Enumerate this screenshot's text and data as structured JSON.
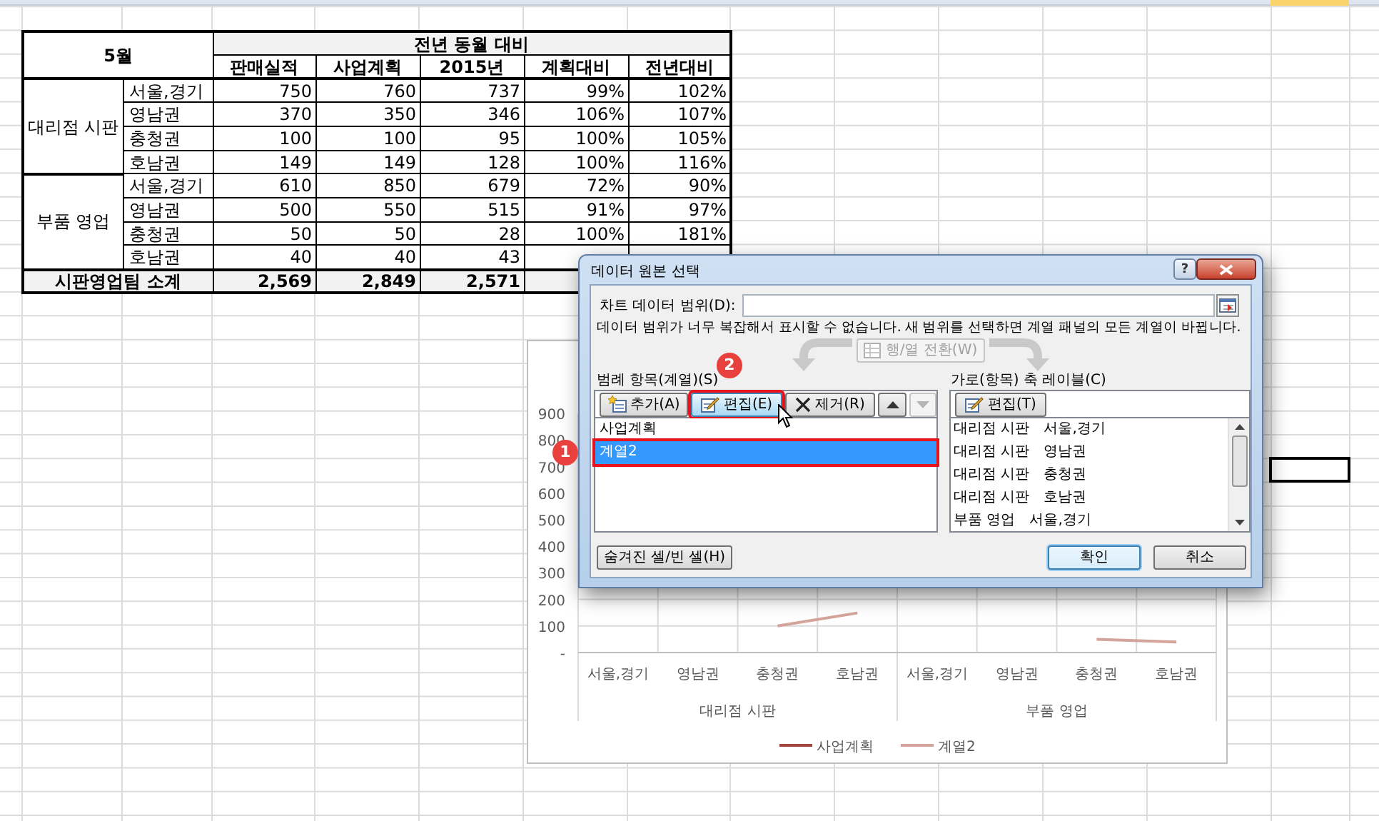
{
  "sheet": {
    "table": {
      "corner": "5월",
      "group_header": "전년 동월 대비",
      "columns": [
        "판매실적",
        "사업계획",
        "2015년",
        "계획대비",
        "전년대비"
      ],
      "groups": [
        {
          "name": "대리점 시판",
          "rows": [
            {
              "region": "서울,경기",
              "cells": [
                "750",
                "760",
                "737",
                "99%",
                "102%"
              ]
            },
            {
              "region": "영남권",
              "cells": [
                "370",
                "350",
                "346",
                "106%",
                "107%"
              ]
            },
            {
              "region": "충청권",
              "cells": [
                "100",
                "100",
                "95",
                "100%",
                "105%"
              ]
            },
            {
              "region": "호남권",
              "cells": [
                "149",
                "149",
                "128",
                "100%",
                "116%"
              ]
            }
          ]
        },
        {
          "name": "부품 영업",
          "rows": [
            {
              "region": "서울,경기",
              "cells": [
                "610",
                "850",
                "679",
                "72%",
                "90%"
              ]
            },
            {
              "region": "영남권",
              "cells": [
                "500",
                "550",
                "515",
                "91%",
                "97%"
              ]
            },
            {
              "region": "충청권",
              "cells": [
                "50",
                "50",
                "28",
                "100%",
                "181%"
              ]
            },
            {
              "region": "호남권",
              "cells": [
                "40",
                "40",
                "43"
              ]
            }
          ]
        }
      ],
      "total": {
        "label": "시판영업팀 소계",
        "cells": [
          "2,569",
          "2,849",
          "2,571"
        ]
      }
    }
  },
  "chart": {
    "chart_data": {
      "type": "line",
      "categories": [
        "서울,경기",
        "영남권",
        "충청권",
        "호남권",
        "서울,경기",
        "영남권",
        "충청권",
        "호남권"
      ],
      "series": [
        {
          "name": "사업계획",
          "color": "#a3463b",
          "values": [
            null,
            null,
            null,
            null,
            null,
            null,
            null,
            null
          ]
        },
        {
          "name": "계열2",
          "color": "#d4a39c",
          "values": [
            null,
            null,
            100,
            149,
            null,
            null,
            50,
            40
          ]
        }
      ],
      "grid": true,
      "legend": true,
      "ylim": [
        0,
        900
      ],
      "yticks": [
        {
          "value": 0,
          "label": "-"
        },
        {
          "value": 100,
          "label": "100"
        },
        {
          "value": 200,
          "label": "200"
        },
        {
          "value": 300,
          "label": "300"
        },
        {
          "value": 400,
          "label": "400"
        },
        {
          "value": 500,
          "label": "500"
        },
        {
          "value": 600,
          "label": "600"
        },
        {
          "value": 700,
          "label": "700"
        },
        {
          "value": 800,
          "label": "800"
        },
        {
          "value": 900,
          "label": "900"
        }
      ]
    },
    "category_groups": [
      "대리점 시판",
      "부품 영업"
    ]
  },
  "dialog": {
    "title": "데이터 원본 선택",
    "help_button": "?",
    "range_label": "차트 데이터 범위(D):",
    "message": "데이터 범위가 너무 복잡해서 표시할 수 없습니다. 새 범위를 선택하면 계열 패널의 모든 계열이 바뀝니다.",
    "switch_button": {
      "label": "행/열 전환(W)",
      "disabled": true
    },
    "series_panel": {
      "label": "범례 항목(계열)(S)",
      "buttons": [
        {
          "kind": "add",
          "label": "추가(A)",
          "disabled": false,
          "hovered": false,
          "outlined": false
        },
        {
          "kind": "edit",
          "label": "편집(E)",
          "disabled": false,
          "hovered": true,
          "outlined": true,
          "callout": "2"
        },
        {
          "kind": "remove",
          "label": "제거(R)",
          "disabled": false,
          "hovered": false,
          "outlined": false
        },
        {
          "kind": "up",
          "disabled": false,
          "hovered": false,
          "outlined": false
        },
        {
          "kind": "down",
          "disabled": true,
          "hovered": false,
          "outlined": false
        }
      ],
      "items": [
        {
          "label": "사업계획",
          "selected": false,
          "outlined": false
        },
        {
          "label": "계열2",
          "selected": true,
          "outlined": true,
          "callout": "1"
        }
      ]
    },
    "category_panel": {
      "label": "가로(항목) 축 레이블(C)",
      "buttons": [
        {
          "kind": "edit",
          "label": "편집(T)",
          "disabled": false,
          "hovered": false,
          "outlined": false
        }
      ],
      "items": [
        {
          "group": "대리점 시판",
          "category": "서울,경기",
          "selected": false
        },
        {
          "group": "대리점 시판",
          "category": "영남권",
          "selected": false
        },
        {
          "group": "대리점 시판",
          "category": "충청권",
          "selected": false
        },
        {
          "group": "대리점 시판",
          "category": "호남권",
          "selected": false
        },
        {
          "group": "부품 영업",
          "category": "서울,경기",
          "selected": false
        }
      ]
    },
    "footer_buttons": [
      {
        "label": "숨겨진 셀/빈 셀(H)",
        "default": false
      },
      {
        "label": "확인",
        "default": true
      },
      {
        "label": "취소",
        "default": false
      }
    ]
  }
}
